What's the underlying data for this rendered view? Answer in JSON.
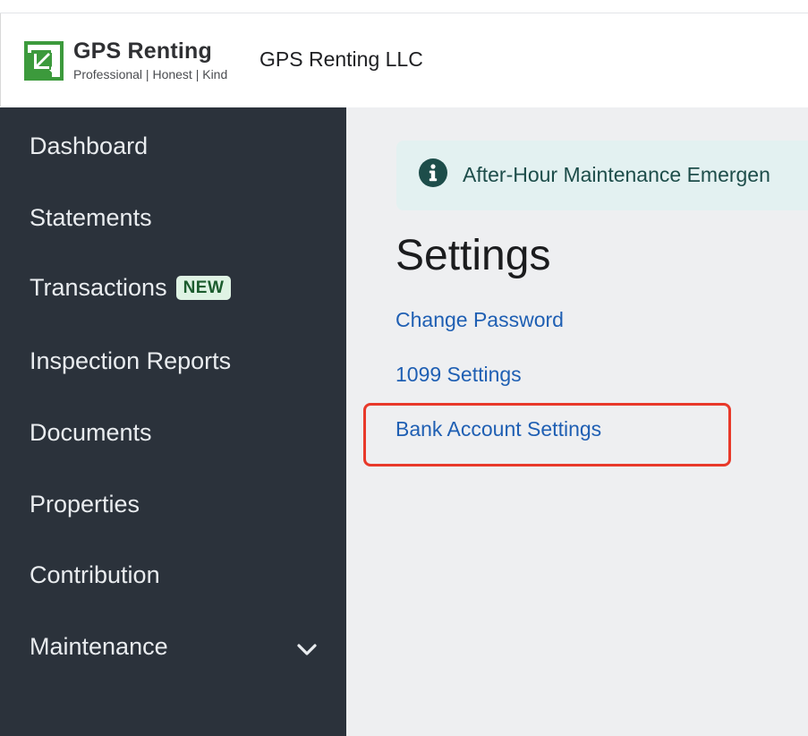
{
  "header": {
    "logo_title": "GPS Renting",
    "logo_tagline": "Professional | Honest | Kind",
    "company_name": "GPS Renting LLC"
  },
  "sidebar": {
    "items": [
      {
        "label": "Dashboard"
      },
      {
        "label": "Statements"
      },
      {
        "label": "Transactions",
        "badge": "NEW"
      },
      {
        "label": "Inspection Reports"
      },
      {
        "label": "Documents"
      },
      {
        "label": "Properties"
      },
      {
        "label": "Contribution"
      },
      {
        "label": "Maintenance",
        "icon": "chevron-down-icon"
      }
    ]
  },
  "main": {
    "alert": {
      "icon": "info-icon",
      "text": "After-Hour Maintenance Emergen"
    },
    "title": "Settings",
    "links": [
      {
        "label": "Change Password"
      },
      {
        "label": "1099 Settings"
      },
      {
        "label": "Bank Account Settings",
        "highlighted": true
      }
    ]
  },
  "colors": {
    "sidebar_bg": "#2b323b",
    "link": "#1f5fb3",
    "brand_green": "#3c9a3c",
    "highlight": "#e8392a",
    "badge_bg": "#dff3e4"
  }
}
